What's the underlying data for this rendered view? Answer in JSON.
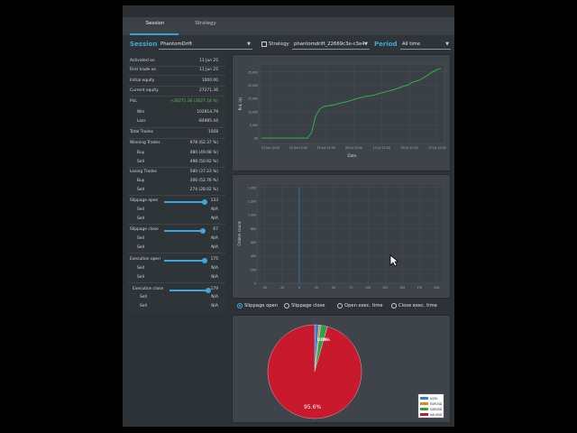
{
  "tabs": [
    {
      "label": "Session"
    },
    {
      "label": "Strategy"
    }
  ],
  "filters": {
    "session_label": "Session",
    "session_value": "PhantomDrift",
    "strategy_label": "Strategy",
    "strategy_value": "phantomdrift_22669c3e-c3e4",
    "period_label": "Period",
    "period_value": "All time"
  },
  "stats": {
    "activated_on": {
      "label": "Activated on",
      "value": "11 Jun 25"
    },
    "first_trade_on": {
      "label": "First trade on",
      "value": "11 Jun 25"
    },
    "initial_equity": {
      "label": "Initial equity",
      "value": "1000.00"
    },
    "current_equity": {
      "label": "Current equity",
      "value": "27271.36"
    },
    "pnl": {
      "label": "PnL",
      "value": "+26271.36 (2627.14 %)"
    },
    "win": {
      "label": "Win",
      "value": "102914.79"
    },
    "loss": {
      "label": "Loss",
      "value": "-84985.44"
    },
    "total_trades": {
      "label": "Total Trades",
      "value": "1568"
    },
    "winning_trades": {
      "label": "Winning Trades",
      "value": "978 (62.37 %)"
    },
    "winning_buy": {
      "label": "Buy",
      "value": "480 (49.08 %)"
    },
    "winning_sell": {
      "label": "Sell",
      "value": "498 (50.92 %)"
    },
    "losing_trades": {
      "label": "Losing Trades",
      "value": "580 (37.23 %)"
    },
    "losing_buy": {
      "label": "Buy",
      "value": "306 (52.76 %)"
    },
    "losing_sell": {
      "label": "Sell",
      "value": "274 (28.02 %)"
    },
    "slippage_open": {
      "label": "Slippage open",
      "value": "133",
      "level": 0.86
    },
    "slippage_open_sell": {
      "label": "Sell",
      "value": "N/A"
    },
    "slippage_open_sell2": {
      "label": "Sell",
      "value": "N/A"
    },
    "slippage_close": {
      "label": "Slippage close",
      "value": "67",
      "level": 0.86
    },
    "slippage_close_sell": {
      "label": "Sell",
      "value": "N/A"
    },
    "slippage_close_sell2": {
      "label": "Sell",
      "value": "N/A"
    },
    "execution_open": {
      "label": "Execution open",
      "value": "175",
      "level": 0.86
    },
    "execution_open_sell": {
      "label": "Sell",
      "value": "N/A"
    },
    "execution_open_sell2": {
      "label": "Sell",
      "value": "N/A"
    },
    "execution_close": {
      "label": "Execution close",
      "value": "179",
      "level": 0.86
    },
    "execution_close_sell": {
      "label": "Sell",
      "value": "N/A"
    },
    "execution_close_sell2": {
      "label": "Sell",
      "value": "N/A"
    }
  },
  "radios": [
    {
      "label": "Slippage open",
      "selected": true
    },
    {
      "label": "Slippage close",
      "selected": false
    },
    {
      "label": "Open exec. time",
      "selected": false
    },
    {
      "label": "Close exec. time",
      "selected": false
    }
  ],
  "colors": {
    "accent": "#43a6db",
    "pnl_line": "#2fbf4a",
    "histogram": "#2a6f8f",
    "pie_main": "#c8192d"
  },
  "chart_data": [
    {
      "type": "line",
      "xlabel": "Date",
      "ylabel": "PnL ($)",
      "x_ticks": [
        "15 Jun 12:00",
        "22 Jun 12:00",
        "29 Jun 12:00",
        "06 Jul 12:00",
        "13 Jul 12:00",
        "20 Jul 12:00",
        "27 Jul 12:00"
      ],
      "y_ticks": [
        "0k",
        "5,000",
        "10,000",
        "15,000",
        "20,000",
        "25,000"
      ],
      "ylim": [
        -2000,
        28000
      ],
      "series": [
        {
          "values": [
            0,
            0,
            0,
            0,
            0,
            0,
            0,
            0,
            0,
            0,
            0,
            0,
            2000,
            8500,
            11000,
            12000,
            12200,
            12500,
            12800,
            13300,
            13600,
            14000,
            14500,
            15000,
            15400,
            15800,
            16000,
            16200,
            16800,
            17200,
            17600,
            18000,
            18500,
            19000,
            19600,
            20000,
            21000,
            21500,
            22000,
            23000,
            24000,
            25000,
            25800,
            26300
          ]
        }
      ]
    },
    {
      "type": "bar",
      "xlabel": "",
      "ylabel": "Orders count",
      "x_ticks": [
        "-50",
        "-25",
        "0",
        "25",
        "50",
        "75",
        "100",
        "125",
        "150",
        "175",
        "200"
      ],
      "y_ticks": [
        "0",
        "200",
        "400",
        "600",
        "800",
        "1,000",
        "1,200",
        "1,400"
      ],
      "ylim": [
        0,
        1450
      ],
      "bins": [
        {
          "x": 0,
          "value": 1400
        },
        {
          "x": 2,
          "value": 8
        },
        {
          "x": 5,
          "value": 4
        }
      ]
    },
    {
      "type": "pie",
      "slices": [
        {
          "label": "US30",
          "value": 1.5,
          "color": "#3b7dd8"
        },
        {
          "label": "EURUSD",
          "value": 0.6,
          "color": "#e08a1e"
        },
        {
          "label": "GBPUSD",
          "value": 2.3,
          "color": "#2ea04a"
        },
        {
          "label": "XAUUSD",
          "value": 95.6,
          "color": "#c8192d"
        }
      ],
      "labels": [
        "95.6%",
        "0.0%",
        "0.0%",
        "0.0%"
      ]
    }
  ]
}
